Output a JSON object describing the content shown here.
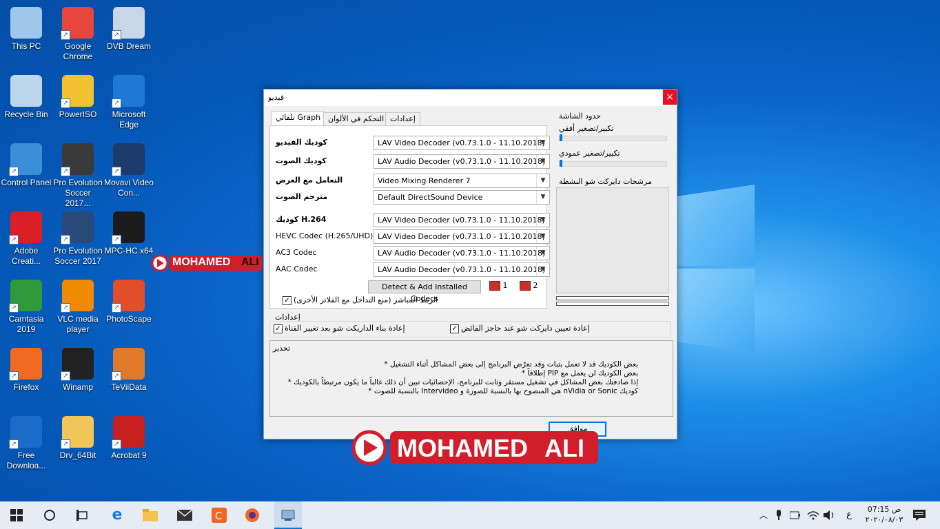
{
  "desktop": {
    "icons": [
      {
        "label": "This PC",
        "color": "#9fc7ec"
      },
      {
        "label": "Google Chrome",
        "color": "#e8453c"
      },
      {
        "label": "DVB Dream",
        "color": "#c9d6e8"
      },
      {
        "label": "Recycle Bin",
        "color": "#bcd6ee"
      },
      {
        "label": "PowerISO",
        "color": "#f2c230"
      },
      {
        "label": "Microsoft Edge",
        "color": "#1e78d6"
      },
      {
        "label": "Control Panel",
        "color": "#3b8fd8"
      },
      {
        "label": "Pro Evolution Soccer 2017...",
        "color": "#3a3a3a"
      },
      {
        "label": "Movavi Video Con...",
        "color": "#1d3c6b"
      },
      {
        "label": "Adobe Creati...",
        "color": "#da1f26"
      },
      {
        "label": "Pro Evolution Soccer 2017",
        "color": "#2a4a7a"
      },
      {
        "label": "MPC-HC x64",
        "color": "#1c1c1c"
      },
      {
        "label": "Camtasia 2019",
        "color": "#2e9a3a"
      },
      {
        "label": "VLC media player",
        "color": "#f08a00"
      },
      {
        "label": "PhotoScape",
        "color": "#e04e2a"
      },
      {
        "label": "Firefox",
        "color": "#f26a22"
      },
      {
        "label": "Winamp",
        "color": "#222222"
      },
      {
        "label": "TeViiData",
        "color": "#e07a2a"
      },
      {
        "label": "Free Downloa...",
        "color": "#1a6cc8"
      },
      {
        "label": "Drv_64Bit",
        "color": "#f1c659"
      },
      {
        "label": "Acrobat 9",
        "color": "#c8201e"
      }
    ]
  },
  "watermark": {
    "word1": "MOHAMED",
    "word2": "ALI"
  },
  "dialog": {
    "title": "فيديو",
    "close": "×",
    "tabs": [
      "تلقائي Graph",
      "التحكم في الألوان",
      "إعدادات"
    ],
    "rows": [
      {
        "label": "كوديك الفيديو",
        "value": "LAV Video Decoder   (v0.73.1.0 - 11.10.2018)"
      },
      {
        "label": "كوديك الصوت",
        "value": "LAV Audio Decoder   (v0.73.1.0 - 11.10.2018)"
      },
      {
        "label": "التعامل مع العرض",
        "value": "Video Mixing Renderer 7"
      },
      {
        "label": "مترجم الصوت",
        "value": "Default DirectSound Device"
      },
      {
        "label": "كوديك H.264",
        "value": "LAV Video Decoder   (v0.73.1.0 - 11.10.2018)"
      },
      {
        "label": "HEVC Codec (H.265/UHD)",
        "value": "LAV Video Decoder   (v0.73.1.0 - 11.10.2018)"
      },
      {
        "label": "AC3 Codec",
        "value": "LAV Audio Decoder   (v0.73.1.0 - 11.10.2018)"
      },
      {
        "label": "AAC Codec",
        "value": "LAV Audio Decoder   (v0.73.1.0 - 11.10.2018)"
      }
    ],
    "detect_button": "Detect & Add Installed Codecs",
    "preset1": "1",
    "preset2": "2",
    "direct_link": "الربط المباشر (منع التداخل مع الفلاتر الأخرى)",
    "screen_limits": "حدود الشاشة",
    "h_zoom": "تكبير/تصغير أفقي",
    "v_zoom": "تكبير/تصغير عمودي",
    "h_zoom_level": 0,
    "v_zoom_level": 0,
    "active_filters": "مرشحات دايركت شو النشطة",
    "settings_group": "إعدادات",
    "opt_reset": "إعادة تعيين دايركت شو عند حاجز الفائض",
    "opt_rebuild": "إعادة بناء الداريكت شو بعد تغيير القناة",
    "warning_title": "تحذير",
    "warnings": [
      "بعض الكوديك قد لا تعمل بثبات وقد تعرّض البرنامج إلى بعض المشاكل أثناء التشغيل  *",
      "بعض الكوديك لن يعمل مع PIP إطلاقاً  *",
      "إذا صادفتك بعض المشاكل في تشغيل مستقر وثابت للبرنامج، الإحصائيات تبين أن ذلك غالباً ما يكون مرتبطاً بالكوديك  *",
      "كوديك nVidia or Sonic هي المنصوح بها بالنسبة للصورة و Intervideo بالنسبة للصوت  *"
    ],
    "ok": "موافق"
  },
  "taskbar": {
    "time": "07:15 ص",
    "date": "٢٠٢٠/٠٨/٠٣",
    "lang": "ع"
  }
}
